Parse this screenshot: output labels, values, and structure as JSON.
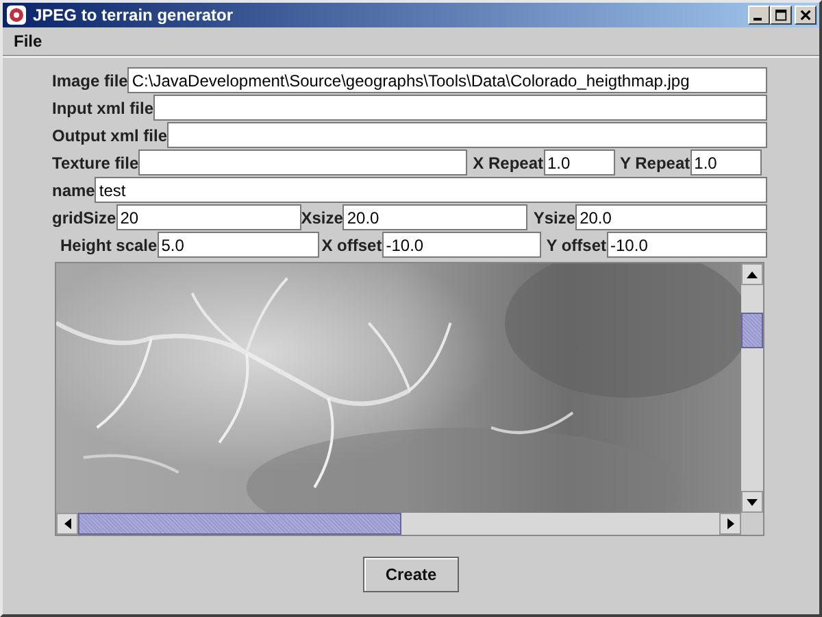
{
  "window": {
    "title": "JPEG to terrain generator"
  },
  "menu": [
    "File"
  ],
  "rows": [
    [
      {
        "label": "Image file",
        "value": "C:\\JavaDevelopment\\Source\\geographs\\Tools\\Data\\Colorado_heigthmap.jpg"
      }
    ],
    [
      {
        "label": "Input xml file"
      }
    ],
    [
      {
        "label": "Output xml file"
      }
    ],
    [
      {
        "label": "Texture file"
      },
      {
        "label": "X Repeat",
        "value": "1.0"
      },
      {
        "label": "Y Repeat",
        "value": "1.0"
      }
    ],
    [
      {
        "label": "name",
        "value": "test"
      }
    ],
    [
      {
        "label": "gridSize",
        "value": "20"
      },
      {
        "label": "Xsize",
        "value": "20.0"
      },
      {
        "label": "Ysize",
        "value": "20.0"
      }
    ],
    [
      {
        "label": "Height scale",
        "value": "5.0"
      },
      {
        "label": "X offset",
        "value": "-10.0"
      },
      {
        "label": "Y offset",
        "value": "-10.0"
      }
    ]
  ],
  "button": "Create"
}
